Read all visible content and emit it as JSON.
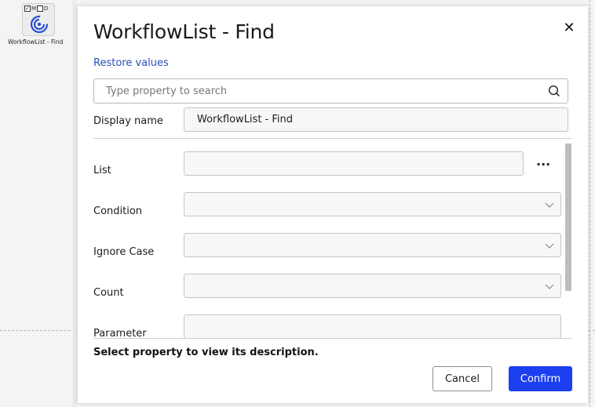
{
  "node": {
    "flag_m": "M",
    "flag_d": "D",
    "label": "WorkflowList - Find",
    "icon": "workflow-spiral-icon"
  },
  "dialog": {
    "title": "WorkflowList - Find",
    "restore_label": "Restore values",
    "search_placeholder": "Type property to search",
    "display_name_label": "Display name",
    "display_name_value": "WorkflowList - Find",
    "fields": {
      "list_label": "List",
      "more_label": "···",
      "condition_label": "Condition",
      "ignore_case_label": "Ignore Case",
      "count_label": "Count",
      "parameter_label": "Parameter"
    },
    "description": "Select property to view its description.",
    "cancel_label": "Cancel",
    "confirm_label": "Confirm"
  },
  "colors": {
    "accent": "#1c3ff0",
    "link": "#2a4fb8"
  }
}
